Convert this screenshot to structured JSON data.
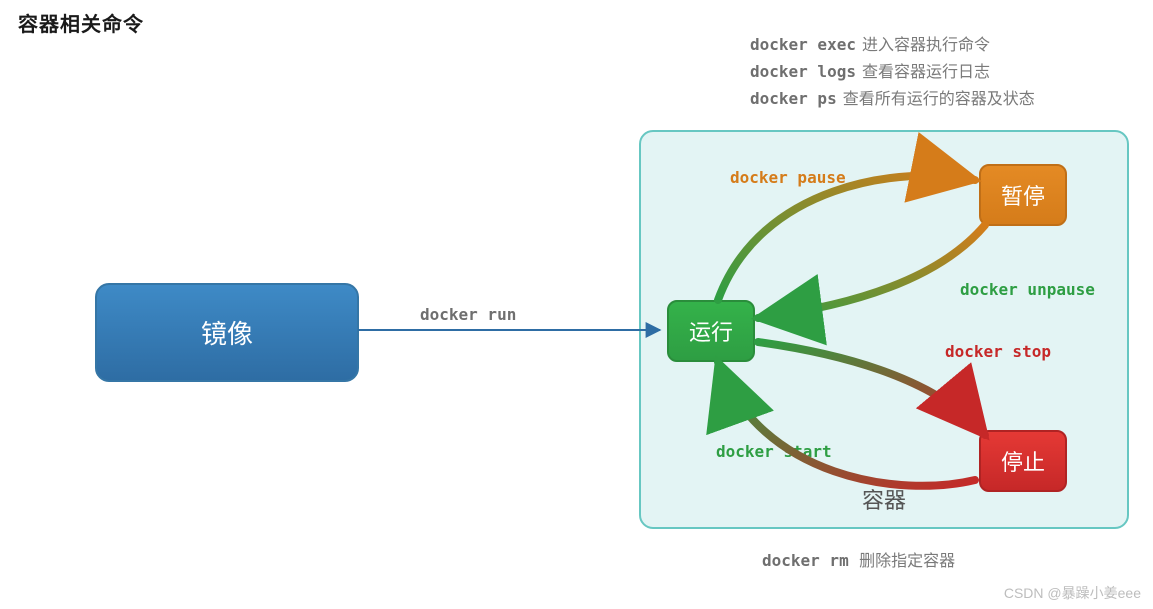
{
  "title": "容器相关命令",
  "legend_top": [
    {
      "cmd": "docker exec",
      "desc": "进入容器执行命令"
    },
    {
      "cmd": "docker logs",
      "desc": "查看容器运行日志"
    },
    {
      "cmd": "docker ps",
      "desc": "查看所有运行的容器及状态"
    }
  ],
  "legend_bottom": {
    "cmd": "docker rm",
    "desc": "删除指定容器"
  },
  "image_box": "镜像",
  "container_box": "容器",
  "nodes": {
    "run": "运行",
    "pause": "暂停",
    "stop": "停止"
  },
  "edges": {
    "run": "docker run",
    "pause": "docker pause",
    "unpause": "docker unpause",
    "stop": "docker stop",
    "start": "docker start"
  },
  "watermark": "CSDN @暴躁小姜eee",
  "colors": {
    "green": "#2e9e43",
    "orange": "#d57c1a",
    "red": "#c62828",
    "blue": "#2e6da4"
  }
}
